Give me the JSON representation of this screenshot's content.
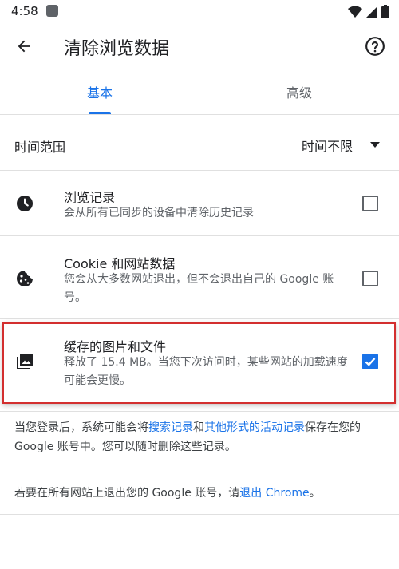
{
  "status_bar": {
    "time": "4:58"
  },
  "app_bar": {
    "title": "清除浏览数据"
  },
  "tabs": [
    {
      "label": "基本",
      "selected": true
    },
    {
      "label": "高级",
      "selected": false
    }
  ],
  "time_range": {
    "label": "时间范围",
    "value": "时间不限"
  },
  "options": [
    {
      "title": "浏览记录",
      "description": "会从所有已同步的设备中清除历史记录",
      "checked": false,
      "icon": "clock-icon"
    },
    {
      "title": "Cookie 和网站数据",
      "description": "您会从大多数网站退出，但不会退出自己的 Google 账号。",
      "checked": false,
      "icon": "cookie-icon"
    },
    {
      "title": "缓存的图片和文件",
      "description": "释放了 15.4 MB。当您下次访问时，某些网站的加载速度可能会更慢。",
      "checked": true,
      "icon": "image-icon"
    }
  ],
  "footer": {
    "part1": "当您登录后，系统可能会将",
    "link1": "搜索记录",
    "part2": "和",
    "link2": "其他形式的活动记录",
    "part3": "保存在您的 Google 账号中。您可以随时删除这些记录。"
  },
  "signout": {
    "part1": "若要在所有网站上退出您的 Google 账号，请",
    "link": "退出 Chrome",
    "part2": "。"
  },
  "colors": {
    "accent": "#1a73e8",
    "highlight_border": "#d32f2f",
    "divider": "#e0e0e0"
  }
}
